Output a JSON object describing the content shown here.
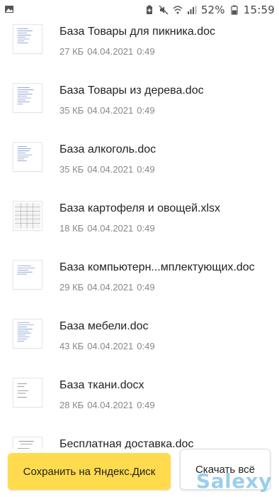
{
  "status_bar": {
    "battery_percent": "52%",
    "time": "15:59",
    "icons": [
      "gallery-icon",
      "battery-saver-icon",
      "mute-icon",
      "wifi-icon",
      "signal-icon",
      "battery-icon"
    ]
  },
  "files": [
    {
      "name": "База Товары для пикника.doc",
      "size": "27 КБ",
      "date": "04.04.2021",
      "time": "0:49",
      "type": "doc"
    },
    {
      "name": "База Товары из дерева.doc",
      "size": "35 КБ",
      "date": "04.04.2021",
      "time": "0:49",
      "type": "doc"
    },
    {
      "name": "База алкоголь.doc",
      "size": "35 КБ",
      "date": "04.04.2021",
      "time": "0:49",
      "type": "doc"
    },
    {
      "name": "База картофеля и овощей.xlsx",
      "size": "18 КБ",
      "date": "04.04.2021",
      "time": "0:49",
      "type": "xlsx"
    },
    {
      "name": "База компьютерн...мплектующих.doc",
      "size": "29 КБ",
      "date": "04.04.2021",
      "time": "0:49",
      "type": "doc"
    },
    {
      "name": "База мебели.doc",
      "size": "43 КБ",
      "date": "04.04.2021",
      "time": "0:49",
      "type": "doc"
    },
    {
      "name": "База ткани.docx",
      "size": "28 КБ",
      "date": "04.04.2021",
      "time": "0:49",
      "type": "docx"
    },
    {
      "name": "Бесплатная доставка.doc",
      "size": "",
      "date": "",
      "time": "",
      "type": "doc"
    }
  ],
  "actions": {
    "save_label": "Сохранить на Яндекс.Диск",
    "download_label": "Скачать всё"
  },
  "watermark": "Salexy",
  "colors": {
    "save_button": "#ffdb4d",
    "meta_text": "#888888",
    "watermark": "#78bee6"
  }
}
